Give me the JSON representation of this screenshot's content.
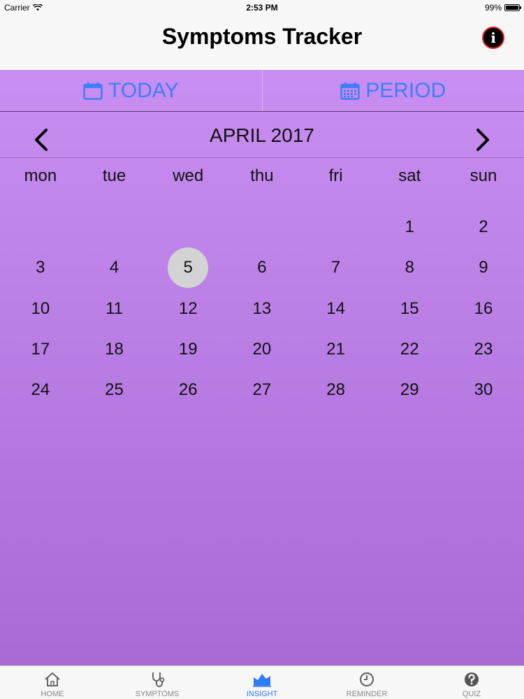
{
  "status": {
    "carrier": "Carrier",
    "time": "2:53 PM",
    "battery": "99%",
    "battery_level": 0.99
  },
  "nav": {
    "title": "Symptoms Tracker",
    "info_icon": "info-icon"
  },
  "segments": {
    "today": "TODAY",
    "period": "PERIOD"
  },
  "calendar": {
    "month": "APRIL 2017",
    "weekdays": [
      "mon",
      "tue",
      "wed",
      "thu",
      "fri",
      "sat",
      "sun"
    ],
    "leading_blanks": 5,
    "days": [
      "1",
      "2",
      "3",
      "4",
      "5",
      "6",
      "7",
      "8",
      "9",
      "10",
      "11",
      "12",
      "13",
      "14",
      "15",
      "16",
      "17",
      "18",
      "19",
      "20",
      "21",
      "22",
      "23",
      "24",
      "25",
      "26",
      "27",
      "28",
      "29",
      "30"
    ],
    "selected_day": "5"
  },
  "tabs": [
    {
      "label": "HOME",
      "icon": "home-icon",
      "active": false
    },
    {
      "label": "SYMPTOMS",
      "icon": "stethoscope-icon",
      "active": false
    },
    {
      "label": "INSIGHT",
      "icon": "chart-icon",
      "active": true
    },
    {
      "label": "REMINDER",
      "icon": "clock-icon",
      "active": false
    },
    {
      "label": "QUIZ",
      "icon": "question-icon",
      "active": false
    }
  ],
  "colors": {
    "accent": "#3d7ff5",
    "active_tab": "#2b7cf6",
    "purple_top": "#c98ef2",
    "purple_bottom": "#a96ad6"
  }
}
